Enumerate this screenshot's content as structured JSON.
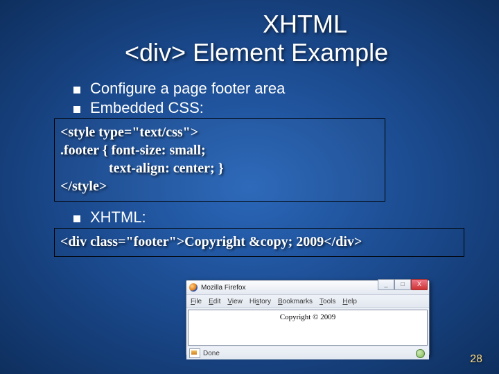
{
  "title": {
    "line1": "XHTML",
    "line2": "<div> Element Example"
  },
  "bullets": {
    "b1": "Configure a page footer area",
    "b2": "Embedded CSS:",
    "b3": "XHTML:"
  },
  "codebox1": {
    "l1": "<style type=\"text/css\">",
    "l2": ".footer { font-size: small;",
    "l3": "text-align: center; }",
    "l4": "</style>"
  },
  "codebox2": {
    "l1": "<div class=\"footer\">Copyright &copy; 2009</div>"
  },
  "browser": {
    "app": "Mozilla Firefox",
    "menu": {
      "file": "File",
      "edit": "Edit",
      "view": "View",
      "history": "History",
      "bookmarks": "Bookmarks",
      "tools": "Tools",
      "help": "Help"
    },
    "page_text": "Copyright © 2009",
    "status": "Done",
    "winbtns": {
      "min": "_",
      "max": "□",
      "close": "X"
    }
  },
  "page_number": "28"
}
